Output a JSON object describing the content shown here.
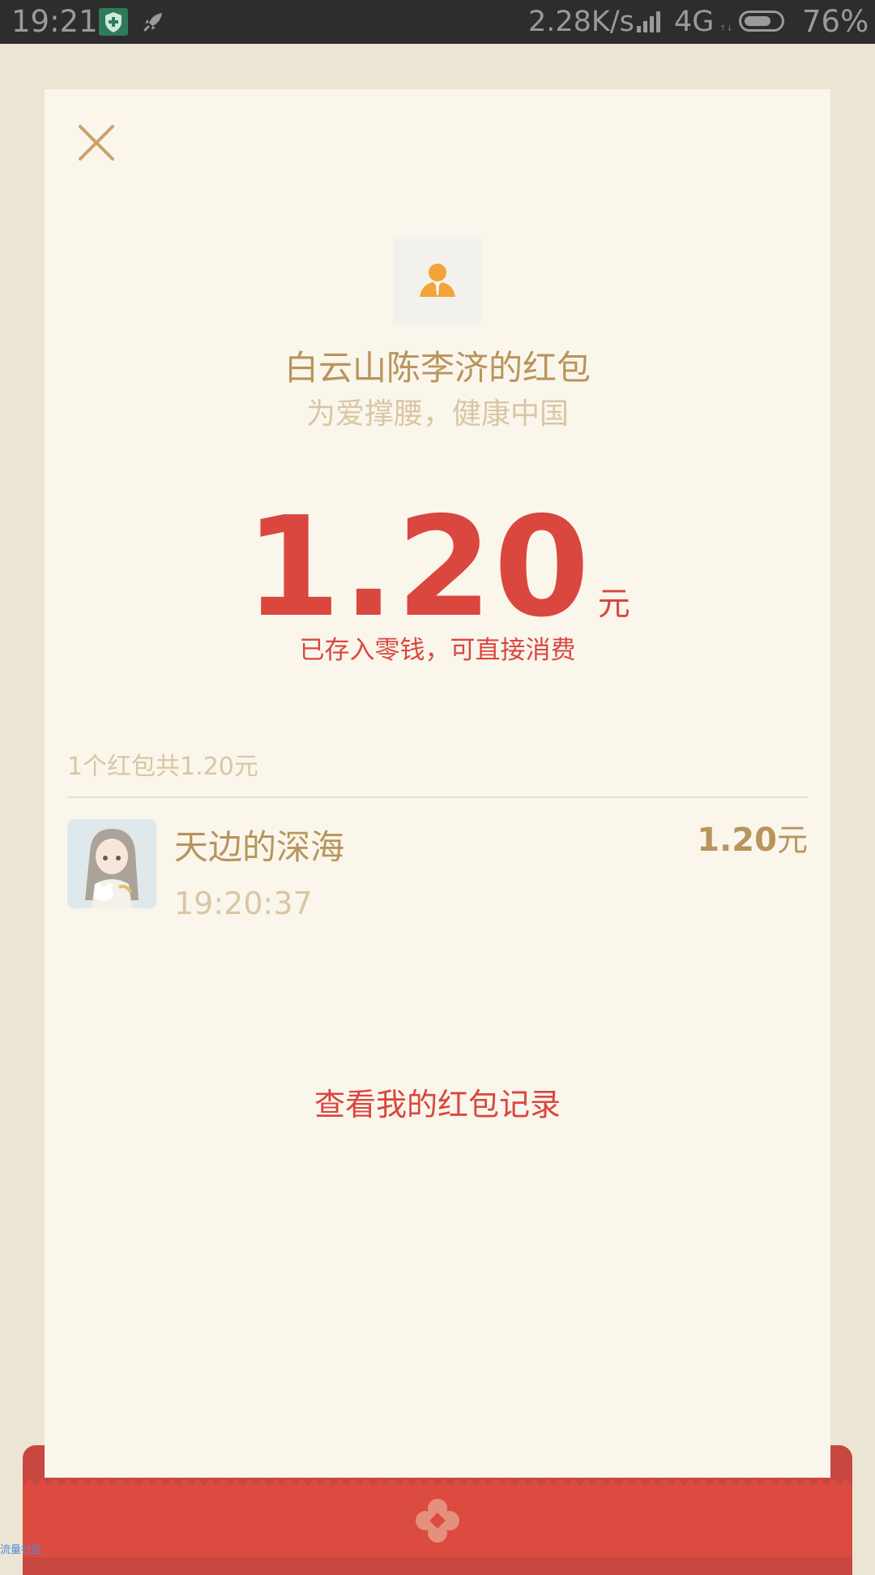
{
  "status_bar": {
    "time": "19:21",
    "net_speed": "2.28K/s",
    "network": "4G",
    "network_sub": "↑↓",
    "battery_level_percent": 76,
    "battery_text": "76%"
  },
  "packet": {
    "sender_title": "白云山陈李济的红包",
    "wish": "为爱撑腰，健康中国",
    "amount": "1.20",
    "unit": "元",
    "note": "已存入零钱，可直接消费"
  },
  "records": {
    "summary": "1个红包共1.20元",
    "items": [
      {
        "name": "天边的深海",
        "time": "19:20:37",
        "amount": "1.20",
        "unit": "元"
      }
    ]
  },
  "history_link": "查看我的红包记录",
  "watermark": "流量社区",
  "colors": {
    "accent_red": "#d9473f",
    "gold_text": "#b8955c",
    "muted_text": "#d9c6a3",
    "card_bg": "#faf6ec",
    "page_bg": "#ede5d4",
    "status_bar_bg": "#2d2d2d"
  },
  "icons": {
    "close": "close-icon",
    "sender_avatar": "person-avatar-icon",
    "shield": "shield-icon",
    "rocket": "rocket-icon",
    "signal": "signal-bars-icon",
    "battery": "battery-icon",
    "envelope_emblem": "flower-emblem-icon"
  }
}
